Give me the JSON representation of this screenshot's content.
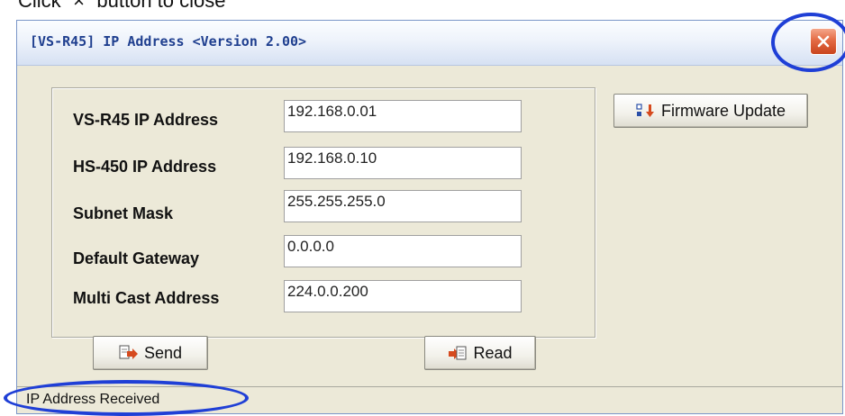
{
  "annotation": {
    "top_text": "Click “×” button to close"
  },
  "window": {
    "title": "[VS-R45] IP Address <Version 2.00>",
    "close_icon": "close-x-icon",
    "accent_color": "#d9532e"
  },
  "fields": [
    {
      "label": "VS-R45 IP Address",
      "value": "192.168.0.01"
    },
    {
      "label": "HS-450 IP Address",
      "value": "192.168.0.10"
    },
    {
      "label": "Subnet Mask",
      "value": "255.255.255.0"
    },
    {
      "label": "Default Gateway",
      "value": "0.0.0.0"
    },
    {
      "label": "Multi Cast Address",
      "value": "224.0.0.200"
    }
  ],
  "buttons": {
    "firmware_update": "Firmware Update",
    "send": "Send",
    "read": "Read"
  },
  "status": {
    "text": "IP Address Received"
  },
  "highlight_color": "#1f3fd6"
}
